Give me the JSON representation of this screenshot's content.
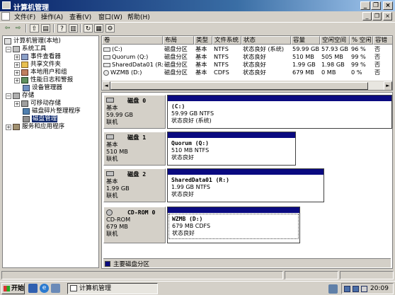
{
  "window": {
    "title": "计算机管理"
  },
  "menu": {
    "items": [
      "文件(F)",
      "操作(A)",
      "查看(V)",
      "窗口(W)",
      "帮助(H)"
    ],
    "mdi_buttons": [
      "_",
      "❐",
      "×"
    ]
  },
  "caption_buttons": [
    "_",
    "❐",
    "×"
  ],
  "toolbar": {
    "back": "⇦",
    "forward": "⇨",
    "up": "⇧",
    "show_tree": "▤",
    "properties": "▥",
    "help": "?",
    "export": "▦",
    "refresh": "↻",
    "action1": "✎",
    "action2": "⚙"
  },
  "tree": {
    "root": "计算机管理(本地)",
    "items": [
      {
        "label": "系统工具",
        "level": 1,
        "expander": "−"
      },
      {
        "label": "事件查看器",
        "level": 2,
        "expander": "+"
      },
      {
        "label": "共享文件夹",
        "level": 2,
        "expander": "+"
      },
      {
        "label": "本地用户和组",
        "level": 2,
        "expander": "+"
      },
      {
        "label": "性能日志和警报",
        "level": 2,
        "expander": "+"
      },
      {
        "label": "设备管理器",
        "level": 2,
        "expander": ""
      },
      {
        "label": "存储",
        "level": 1,
        "expander": "−"
      },
      {
        "label": "可移动存储",
        "level": 2,
        "expander": "+"
      },
      {
        "label": "磁盘碎片整理程序",
        "level": 2,
        "expander": ""
      },
      {
        "label": "磁盘管理",
        "level": 2,
        "expander": "",
        "selected": true
      },
      {
        "label": "服务和应用程序",
        "level": 1,
        "expander": "+"
      }
    ]
  },
  "volume_list": {
    "columns": [
      "卷",
      "布局",
      "类型",
      "文件系统",
      "状态",
      "容量",
      "空闲空间",
      "% 空闲",
      "容错"
    ],
    "rows": [
      [
        "(C:)",
        "磁盘分区",
        "基本",
        "NTFS",
        "状态良好 (系统)",
        "59.99 GB",
        "57.93 GB",
        "96 %",
        "否"
      ],
      [
        "Quorum (Q:)",
        "磁盘分区",
        "基本",
        "NTFS",
        "状态良好",
        "510 MB",
        "505 MB",
        "99 %",
        "否"
      ],
      [
        "SharedData01 (R:)",
        "磁盘分区",
        "基本",
        "NTFS",
        "状态良好",
        "1.99 GB",
        "1.98 GB",
        "99 %",
        "否"
      ],
      [
        "WZMB (D:)",
        "磁盘分区",
        "基本",
        "CDFS",
        "状态良好",
        "679 MB",
        "0 MB",
        "0 %",
        "否"
      ]
    ]
  },
  "disks": [
    {
      "name": "磁盘 0",
      "type": "基本",
      "size": "59.99 GB",
      "status": "联机",
      "part_name": "(C:)",
      "part_fs": "59.99 GB NTFS",
      "part_status": "状态良好 (系统)"
    },
    {
      "name": "磁盘 1",
      "type": "基本",
      "size": "510 MB",
      "status": "联机",
      "part_name": "Quorum  (Q:)",
      "part_fs": "510 MB NTFS",
      "part_status": "状态良好"
    },
    {
      "name": "磁盘 2",
      "type": "基本",
      "size": "1.99 GB",
      "status": "联机",
      "part_name": "SharedData01  (R:)",
      "part_fs": "1.99 GB NTFS",
      "part_status": "状态良好"
    },
    {
      "name": "CD-ROM 0",
      "type": "CD-ROM",
      "size": "679 MB",
      "status": "联机",
      "part_name": "WZMB  (D:)",
      "part_fs": "679 MB CDFS",
      "part_status": "状态良好"
    }
  ],
  "legend": {
    "label": "主要磁盘分区",
    "color": "#0a0a80"
  },
  "taskbar": {
    "start": "开始",
    "task": "计算机管理",
    "clock": "20:09"
  },
  "colors": {
    "titlebar": "#0a246a",
    "partition": "#0a0a80",
    "selection": "#0a246a"
  }
}
